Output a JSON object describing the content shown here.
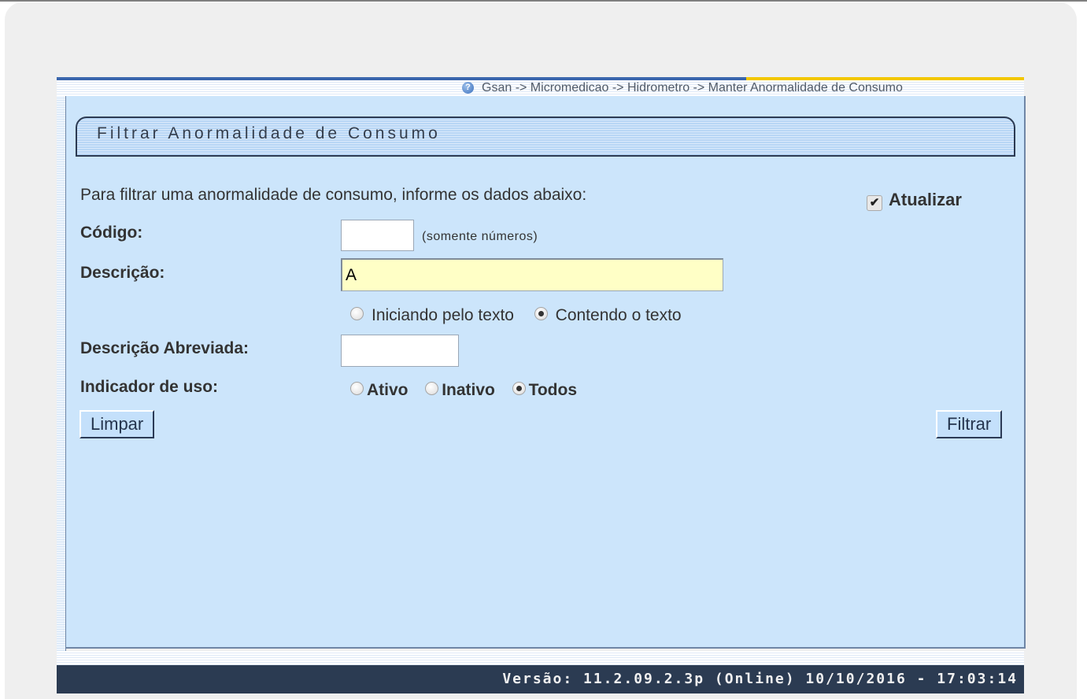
{
  "breadcrumb": {
    "text": "Gsan -> Micromedicao -> Hidrometro -> Manter Anormalidade de Consumo",
    "help_icon": "help-circle-icon"
  },
  "title": "Filtrar Anormalidade de Consumo",
  "form": {
    "instructions": "Para filtrar uma anormalidade de consumo, informe os dados abaixo:",
    "atualizar": {
      "label": "Atualizar",
      "checked": true,
      "check_glyph": "✔"
    },
    "codigo": {
      "label": "Código:",
      "value": "",
      "hint": "(somente números)"
    },
    "descricao": {
      "label": "Descrição:",
      "value": "A"
    },
    "descricao_options": {
      "iniciando": "Iniciando pelo texto",
      "contendo": "Contendo o texto",
      "selected": "contendo"
    },
    "descricao_abreviada": {
      "label": "Descrição Abreviada:",
      "value": ""
    },
    "indicador_uso": {
      "label": "Indicador de uso:",
      "ativo": "Ativo",
      "inativo": "Inativo",
      "todos": "Todos",
      "selected": "todos"
    }
  },
  "buttons": {
    "limpar": "Limpar",
    "filtrar": "Filtrar"
  },
  "footer": {
    "version": "Versão: 11.2.09.2.3p (Online) 10/10/2016 - 17:03:14"
  },
  "colors": {
    "panel": "#cce5fb",
    "footer": "#2b3b52",
    "input_highlight": "#ffffc6"
  }
}
